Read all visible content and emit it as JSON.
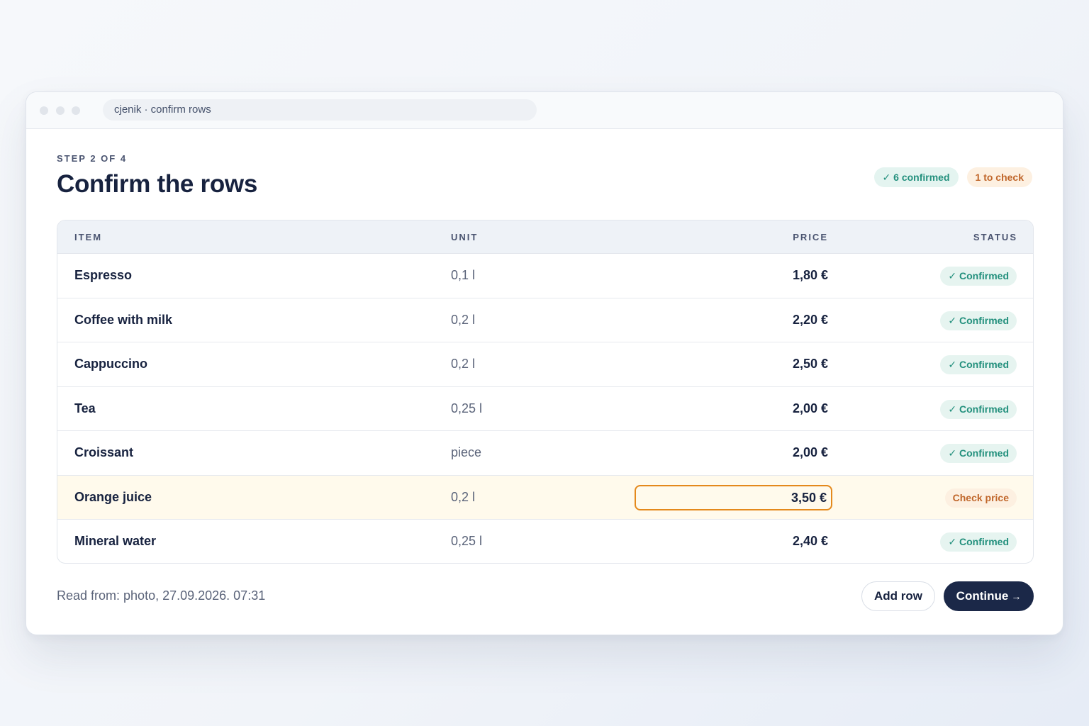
{
  "window": {
    "address": "cjenik · confirm rows"
  },
  "page": {
    "step": "STEP 2 OF 4",
    "title": "Confirm the rows",
    "summary": {
      "confirmed": "✓ 6 confirmed",
      "to_check": "1 to check"
    }
  },
  "table": {
    "headers": {
      "item": "ITEM",
      "unit": "UNIT",
      "price": "PRICE",
      "status": "STATUS"
    },
    "rows": [
      {
        "item": "Espresso",
        "unit": "0,1 l",
        "price": "1,80 €",
        "status": "✓ Confirmed"
      },
      {
        "item": "Coffee with milk",
        "unit": "0,2 l",
        "price": "2,20 €",
        "status": "✓ Confirmed"
      },
      {
        "item": "Cappuccino",
        "unit": "0,2 l",
        "price": "2,50 €",
        "status": "✓ Confirmed"
      },
      {
        "item": "Tea",
        "unit": "0,25 l",
        "price": "2,00 €",
        "status": "✓ Confirmed"
      },
      {
        "item": "Croissant",
        "unit": "piece",
        "price": "2,00 €",
        "status": "✓ Confirmed"
      },
      {
        "item": "Orange juice",
        "unit": "0,2 l",
        "price": "3,50 €",
        "status": "Check price"
      },
      {
        "item": "Mineral water",
        "unit": "0,25 l",
        "price": "2,40 €",
        "status": "✓ Confirmed"
      }
    ]
  },
  "footer": {
    "source": "Read from: photo, 27.09.2026. 07:31",
    "add_row": "Add row",
    "continue": "Continue",
    "continue_arrow": "→"
  },
  "colors": {
    "accent": "#1b2848",
    "confirmed": "#23907d",
    "warning": "#c0662a",
    "highlight_border": "#e4891c"
  }
}
